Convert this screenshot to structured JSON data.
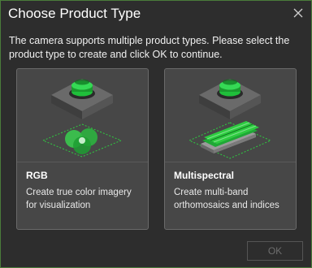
{
  "dialog": {
    "title": "Choose Product Type",
    "intro": "The camera supports multiple product types. Please select the product type to create and click OK to continue.",
    "close_icon": "close-icon"
  },
  "cards": [
    {
      "name": "RGB",
      "description": "Create true color imagery for visualization",
      "icon": "rgb-camera-icon"
    },
    {
      "name": "Multispectral",
      "description": "Create multi-band orthomosaics and indices",
      "icon": "multispectral-camera-icon"
    }
  ],
  "buttons": {
    "ok_label": "OK",
    "ok_enabled": false
  },
  "colors": {
    "background": "#2d2d2d",
    "card": "#474747",
    "accent_green": "#2ecc40",
    "border_accent": "#4a7c3a"
  }
}
